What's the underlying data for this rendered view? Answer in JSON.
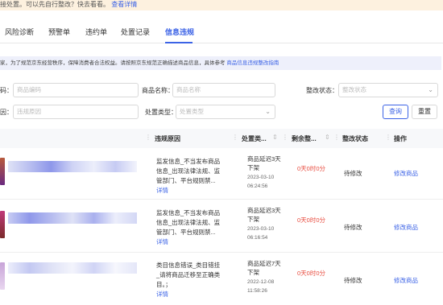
{
  "notice": {
    "text": "接处置。可以先自行整改？快去看看。",
    "link": "查看详情"
  },
  "tabs": [
    "风险诊断",
    "预警单",
    "违约单",
    "处置记录",
    "信息违规"
  ],
  "info": {
    "text": "家，为了规范京东经营秩序，保障消费者合法权益。请按照京东规范正确描述商品信息，具体参考",
    "link": "商品信息违规整改指南"
  },
  "filters": {
    "code_label": "码：",
    "code_placeholder": "商品编码",
    "name_label": "商品名称：",
    "name_placeholder": "商品名称",
    "status_label": "整改状态：",
    "status_placeholder": "整改状态",
    "reason_label": "因：",
    "reason_placeholder": "违规原因",
    "type_label": "处置类型：",
    "type_placeholder": "处置类型",
    "query_label": "查询",
    "reset_label": "重置"
  },
  "columns": [
    "违规原因",
    "处置类...",
    "剩余整...",
    "整改状态",
    "操作"
  ],
  "rows": [
    {
      "reason": "监发信息_不当发布商品信息_出现法律法规、监管部门、平台规则禁...",
      "detail": "详情",
      "type": "商品延迟3天下架",
      "time": "2023-03-10 06:24:56",
      "remain": "0天0时0分",
      "status": "待修改",
      "action": "修改商品"
    },
    {
      "reason": "监发信息_不当发布商品信息_出现法律法规、监管部门、平台规则禁...",
      "detail": "详情",
      "type": "商品延迟3天下架",
      "time": "2023-03-10 06:16:54",
      "remain": "0天0时0分",
      "status": "待修改",
      "action": "修改商品"
    },
    {
      "reason": "类目信息错误_类目错挂_请将商品迁移至正确类目。；",
      "detail": "详情",
      "type": "商品延迟7天下架",
      "time": "2022-12-08 11:58:26",
      "remain": "0天0时0分",
      "status": "待修改",
      "action": "修改商品"
    }
  ],
  "colors": {
    "accent": "#3c63e6",
    "warning": "#e84a3d",
    "notice_bg": "#fdf1df",
    "info_bg": "#eef0fb"
  }
}
